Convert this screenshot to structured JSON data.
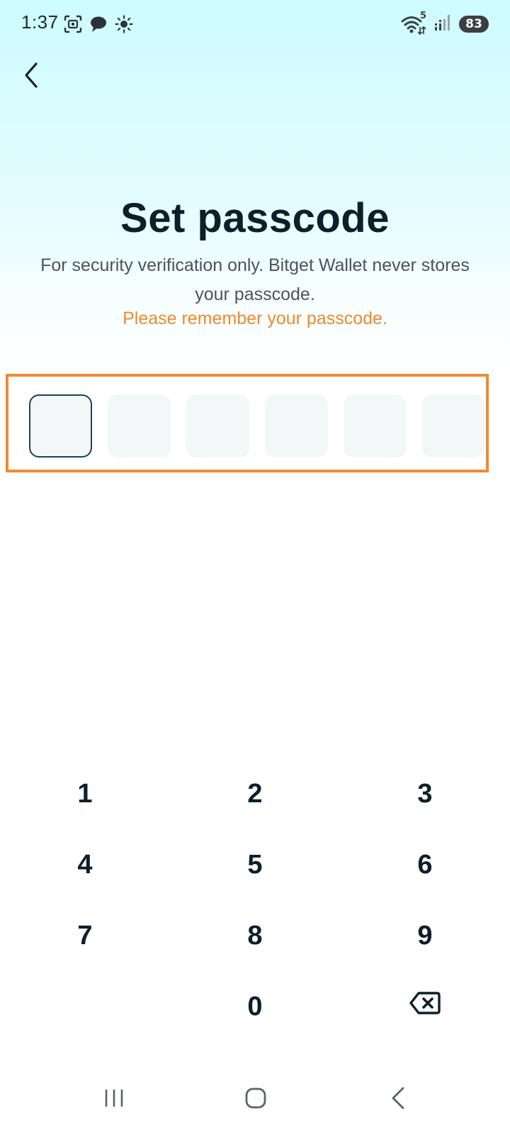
{
  "status_bar": {
    "time": "1:37",
    "left_icons": [
      "screenshot-icon",
      "chat-bubble-icon",
      "brightness-icon"
    ],
    "wifi_badge": "5",
    "battery_level": "83"
  },
  "header": {
    "back_icon": "chevron-left-icon"
  },
  "title": "Set passcode",
  "subtitle": "For security verification only. Bitget Wallet never stores your passcode.",
  "warning": "Please remember your passcode.",
  "passcode": {
    "length": 6,
    "active_index": 0
  },
  "keypad": {
    "keys": [
      "1",
      "2",
      "3",
      "4",
      "5",
      "6",
      "7",
      "8",
      "9",
      "0"
    ],
    "delete_icon": "backspace-icon"
  },
  "nav_bar": {
    "icons": [
      "recents-icon",
      "home-icon",
      "back-icon"
    ]
  },
  "colors": {
    "accent_warning": "#ec8a2f",
    "highlight_border": "#f08a35",
    "title": "#0c1f2a",
    "active_cell_border": "#1a4552"
  }
}
